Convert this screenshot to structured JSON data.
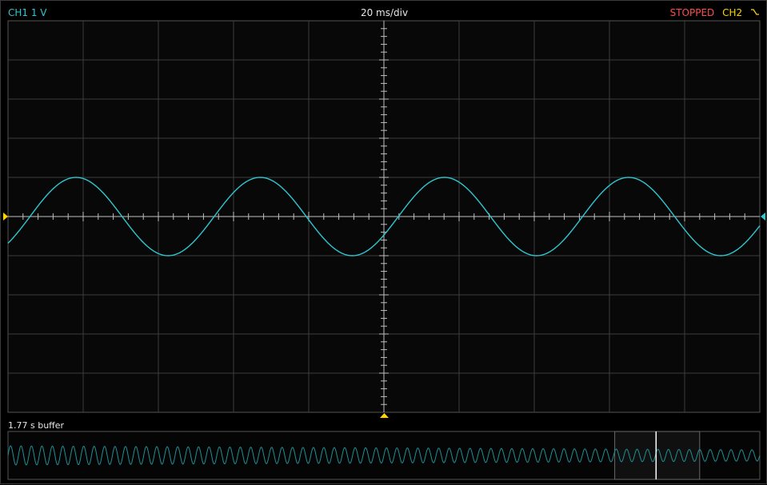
{
  "header": {
    "channel1": "CH1 1 V",
    "timebase": "20 ms/div",
    "status": "STOPPED",
    "channel2": "CH2",
    "trigger_icon": "falling-edge-trigger-icon"
  },
  "overview": {
    "buffer_label": "1.77 s buffer"
  },
  "colors": {
    "background": "#000000",
    "grid": "#3c3c3c",
    "axis": "#bfbfbf",
    "ch1": "#2fc7cf",
    "status": "#ff4d4d",
    "ch2": "#ffd400",
    "trigger_marker": "#ffd400",
    "cursor": "#ffffff",
    "overview_trace": "#1f8f95"
  },
  "scope": {
    "h_divisions": 10,
    "v_divisions": 10,
    "minor_per_div": 5,
    "time_per_div_ms": 20,
    "volts_per_div": 1
  },
  "trace": {
    "amplitude_div": 1.0,
    "period_div": 2.45,
    "phase_rad": -0.75,
    "offset_div": 0
  },
  "overview_trace": {
    "cycles": 72,
    "view_start_frac": 0.807,
    "view_end_frac": 0.92,
    "cursor_frac": 0.862
  }
}
